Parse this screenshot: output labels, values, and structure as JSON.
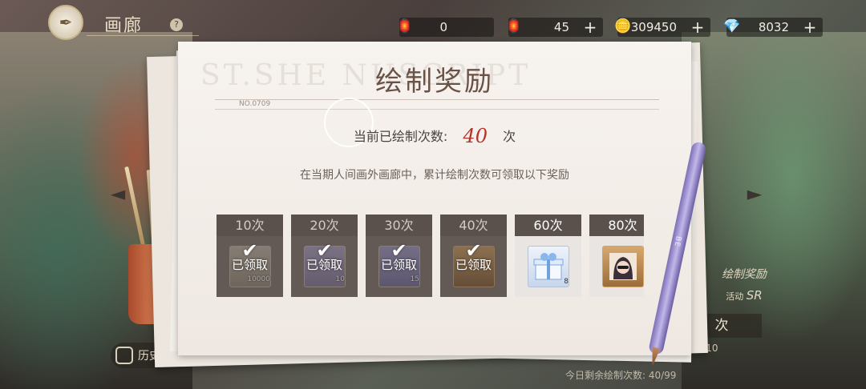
{
  "header": {
    "title": "画廊",
    "help_symbol": "?",
    "back_symbol": "✒"
  },
  "currencies": [
    {
      "icon": "lamp-icon",
      "symbol": "🏮",
      "value": "0",
      "plus": ""
    },
    {
      "icon": "lamp-icon",
      "symbol": "🏮",
      "value": "45",
      "plus": "+"
    },
    {
      "icon": "coin-icon",
      "symbol": "🪙",
      "value": "309450",
      "plus": "+"
    },
    {
      "icon": "gem-icon",
      "symbol": "💎",
      "value": "8032",
      "plus": "+"
    }
  ],
  "modal": {
    "watermark": "ST.SHE          NUSCRIPT",
    "title": "绘制奖励",
    "serial": "NO.0709",
    "count_label": "当前已绘制次数:",
    "count_value": "40",
    "count_unit": "次",
    "description": "在当期人间画外画廊中，累计绘制次数可领取以下奖励",
    "rewards": [
      {
        "label": "10次",
        "qty": "10000",
        "claimed": true,
        "claimed_text": "已领取",
        "check": "✔",
        "icon": "coin-pile-icon"
      },
      {
        "label": "20次",
        "qty": "10",
        "claimed": true,
        "claimed_text": "已领取",
        "check": "✔",
        "icon": "bowl-icon"
      },
      {
        "label": "30次",
        "qty": "15",
        "claimed": true,
        "claimed_text": "已领取",
        "check": "✔",
        "icon": "flower-icon"
      },
      {
        "label": "40次",
        "qty": "",
        "claimed": true,
        "claimed_text": "已领取",
        "check": "✔",
        "icon": "portrait-icon"
      },
      {
        "label": "60次",
        "qty": "8",
        "claimed": false,
        "claimed_text": "",
        "check": "",
        "icon": "gift-box-icon"
      },
      {
        "label": "80次",
        "qty": "",
        "claimed": false,
        "claimed_text": "",
        "check": "",
        "icon": "portrait-icon"
      }
    ]
  },
  "background": {
    "left_arrow": "◄",
    "right_arrow": "►",
    "history_label": "历史记录",
    "draw_title": "绘制奖励",
    "draw_sub": "活动",
    "draw_badge": "SR",
    "draw_button": "次",
    "draw_x10": "X10",
    "remaining": "今日剩余绘制次数: 40/99",
    "pen_label": "BE"
  }
}
